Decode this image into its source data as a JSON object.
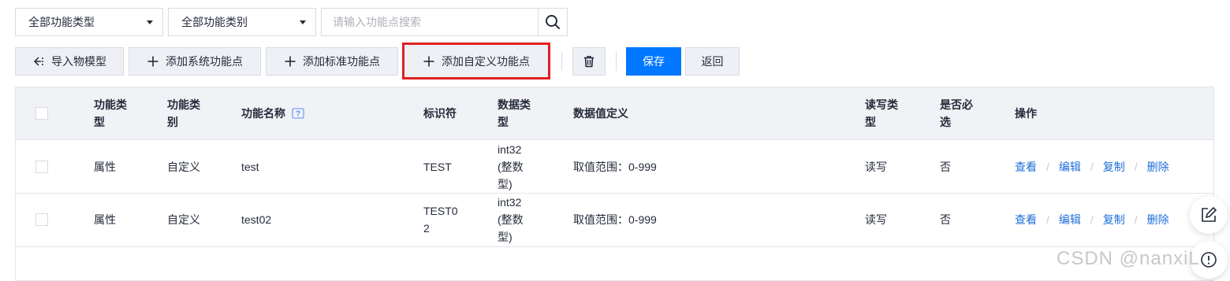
{
  "filters": {
    "type_select": "全部功能类型",
    "category_select": "全部功能类别",
    "search_placeholder": "请输入功能点搜索"
  },
  "toolbar": {
    "import_model": "导入物模型",
    "add_system": "添加系统功能点",
    "add_standard": "添加标准功能点",
    "add_custom": "添加自定义功能点",
    "save": "保存",
    "back": "返回"
  },
  "table": {
    "headers": {
      "type": "功能类\n型",
      "category": "功能类\n别",
      "name": "功能名称",
      "identifier": "标识符",
      "data_type": "数据类\n型",
      "data_def": "数据值定义",
      "rw_type": "读写类\n型",
      "required": "是否必\n选",
      "actions": "操作"
    },
    "rows": [
      {
        "type": "属性",
        "category": "自定义",
        "name": "test",
        "identifier": "TEST",
        "data_type": "int32\n(整数\n型)",
        "data_def": "取值范围：0-999",
        "rw": "读写",
        "required": "否"
      },
      {
        "type": "属性",
        "category": "自定义",
        "name": "test02",
        "identifier": "TEST0\n2",
        "data_type": "int32\n(整数\n型)",
        "data_def": "取值范围：0-999",
        "rw": "读写",
        "required": "否"
      }
    ],
    "actions": [
      "查看",
      "编辑",
      "复制",
      "删除"
    ]
  },
  "watermark": "CSDN @nanxiL",
  "colors": {
    "primary": "#0077ff",
    "highlight": "#e02020",
    "link": "#1e6fd9"
  }
}
